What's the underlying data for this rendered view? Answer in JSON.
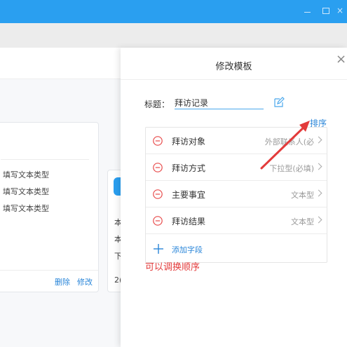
{
  "window": {
    "minimize_glyph": "minimize-icon",
    "maximize_glyph": "maximize-icon",
    "close_glyph": "×"
  },
  "left_cards": [
    {
      "rows": [
        "填写文本类型",
        "填写文本类型",
        "填写文本类型"
      ],
      "actions": {
        "delete": "删除",
        "edit": "修改"
      }
    },
    {
      "rows": [
        "本",
        "本",
        "下",
        "2("
      ]
    }
  ],
  "panel": {
    "title": "修改模板",
    "close_glyph": "×",
    "name_label": "标题：",
    "name_value": "拜访记录",
    "sort_label": "排序",
    "fields": [
      {
        "name": "拜访对象",
        "type": "外部联系人(必"
      },
      {
        "name": "拜访方式",
        "type": "下拉型(必填)"
      },
      {
        "name": "主要事宜",
        "type": "文本型"
      },
      {
        "name": "拜访结果",
        "type": "文本型"
      }
    ],
    "add_field_label": "添加字段",
    "annotation": "可以调换顺序"
  },
  "colors": {
    "titlebar": "#2a9ff0",
    "link": "#2a86d9",
    "remove_icon": "#e84c4c",
    "annotation": "#e33b3b"
  }
}
